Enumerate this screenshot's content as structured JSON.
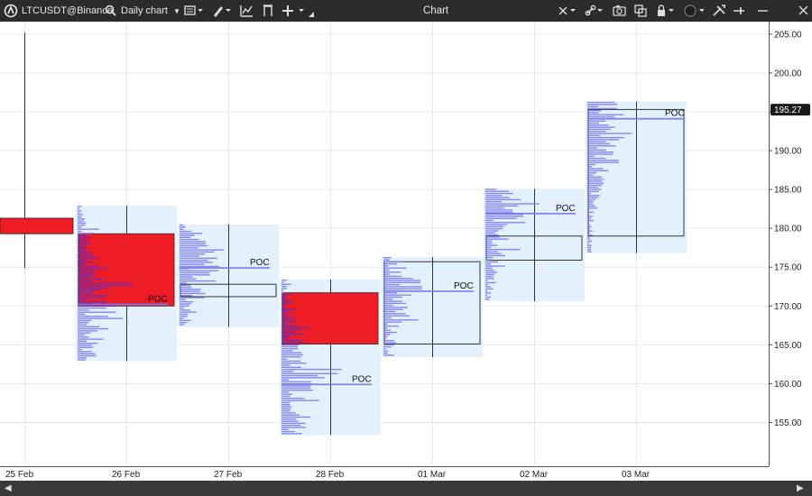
{
  "toolbar": {
    "app_icon": "logo-icon",
    "symbol": "LTCUSDT@Binance",
    "search_icon": "search-icon",
    "timeframe": "Daily chart",
    "title": "Chart",
    "icons": [
      "monitor-icon",
      "pencil-icon",
      "indicator-icon",
      "template-icon",
      "plus-icon",
      "crosshair-icon",
      "link-icon",
      "camera-icon",
      "copy-icon",
      "lock-icon",
      "circle-icon",
      "tools-icon",
      "pin-icon",
      "minimize-icon",
      "close-icon"
    ]
  },
  "colors": {
    "box_fill": "#e3f0fd",
    "profile": "#7b7cf0",
    "profile_dark": "#6f2bb0",
    "red": "#ee1c25",
    "grid": "#e9e9e9",
    "outline": "#222222",
    "price_badge_bg": "#1a1a1a",
    "price_badge_text": "#ffffff"
  },
  "chart_data": {
    "type": "market profile (daily candles with volume profiles)",
    "symbol": "LTCUSDT@Binance",
    "timeframe": "Daily",
    "x_labels": [
      "25 Feb",
      "26 Feb",
      "27 Feb",
      "28 Feb",
      "01 Mar",
      "02 Mar",
      "03 Mar"
    ],
    "y_ticks": [
      155,
      160,
      165,
      170,
      175,
      180,
      185,
      190,
      195,
      200,
      205
    ],
    "y_tick_labels": [
      "155.00",
      "160.00",
      "165.00",
      "170.00",
      "175.00",
      "180.00",
      "185.00",
      "190.00",
      "195.00",
      "200.00",
      "205.00"
    ],
    "ylim": [
      151.5,
      207
    ],
    "last_price": 195.27,
    "last_price_label": "195.27",
    "poc_label": "POC",
    "grid": true,
    "days": [
      {
        "label": "25 Feb",
        "high": 205.2,
        "low": 174.9,
        "open": 181.3,
        "close": 179.3,
        "bearish": true,
        "poc": null,
        "profile": false
      },
      {
        "label": "26 Feb",
        "high": 182.9,
        "low": 162.9,
        "open": 179.3,
        "close": 170.0,
        "bearish": true,
        "poc": 170.2,
        "profile": true
      },
      {
        "label": "27 Feb",
        "high": 180.5,
        "low": 167.3,
        "open": 172.8,
        "close": 171.2,
        "bearish": false,
        "poc": 174.9,
        "profile": true
      },
      {
        "label": "28 Feb",
        "high": 173.4,
        "low": 153.4,
        "open": 171.7,
        "close": 165.1,
        "bearish": true,
        "poc": 159.9,
        "profile": true
      },
      {
        "label": "01 Mar",
        "high": 176.3,
        "low": 163.4,
        "open": 165.1,
        "close": 175.7,
        "bearish": false,
        "poc": 171.9,
        "profile": true
      },
      {
        "label": "02 Mar",
        "high": 185.1,
        "low": 170.6,
        "open": 175.9,
        "close": 179.0,
        "bearish": false,
        "poc": 181.9,
        "profile": true
      },
      {
        "label": "03 Mar",
        "high": 196.3,
        "low": 176.8,
        "open": 179.0,
        "close": 195.3,
        "bearish": false,
        "poc": 194.1,
        "profile": true
      }
    ]
  }
}
